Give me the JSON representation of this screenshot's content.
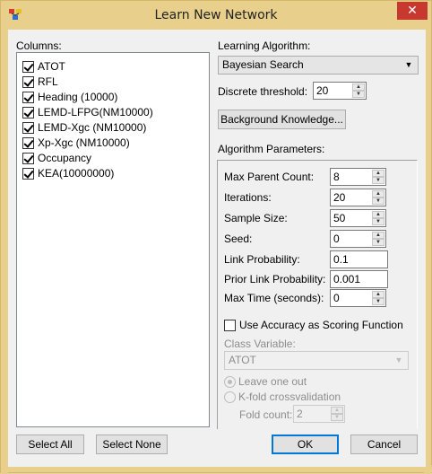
{
  "window": {
    "title": "Learn New Network"
  },
  "columns": {
    "label": "Columns:",
    "items": [
      {
        "label": "ATOT",
        "checked": true
      },
      {
        "label": "RFL",
        "checked": true
      },
      {
        "label": "Heading (10000)",
        "checked": true
      },
      {
        "label": "LEMD-LFPG(NM10000)",
        "checked": true
      },
      {
        "label": "LEMD-Xgc (NM10000)",
        "checked": true
      },
      {
        "label": "Xp-Xgc (NM10000)",
        "checked": true
      },
      {
        "label": "Occupancy",
        "checked": true
      },
      {
        "label": "KEA(10000000)",
        "checked": true
      }
    ]
  },
  "algorithm": {
    "label": "Learning Algorithm:",
    "selected": "Bayesian Search",
    "threshold_label": "Discrete threshold:",
    "threshold_value": "20",
    "background_button": "Background Knowledge..."
  },
  "params": {
    "label": "Algorithm Parameters:",
    "max_parent_count": {
      "label": "Max Parent Count:",
      "value": "8"
    },
    "iterations": {
      "label": "Iterations:",
      "value": "20"
    },
    "sample_size": {
      "label": "Sample Size:",
      "value": "50"
    },
    "seed": {
      "label": "Seed:",
      "value": "0"
    },
    "link_probability": {
      "label": "Link Probability:",
      "value": "0.1"
    },
    "prior_link_probability": {
      "label": "Prior Link Probability:",
      "value": "0.001"
    },
    "max_time": {
      "label": "Max Time (seconds):",
      "value": "0"
    },
    "use_accuracy": {
      "label": "Use Accuracy as Scoring Function",
      "checked": false
    },
    "class_variable": {
      "label": "Class Variable:",
      "value": "ATOT"
    },
    "leave_one_out": {
      "label": "Leave one out",
      "checked": true
    },
    "kfold": {
      "label": "K-fold crossvalidation",
      "checked": false
    },
    "fold_count": {
      "label": "Fold count:",
      "value": "2"
    }
  },
  "buttons": {
    "select_all": "Select All",
    "select_none": "Select None",
    "ok": "OK",
    "cancel": "Cancel"
  },
  "colors": {
    "title_bar": "#e8d08c",
    "close_button": "#c7382e",
    "dialog_bg": "#f0f0f0",
    "default_button_border": "#0078d7"
  }
}
